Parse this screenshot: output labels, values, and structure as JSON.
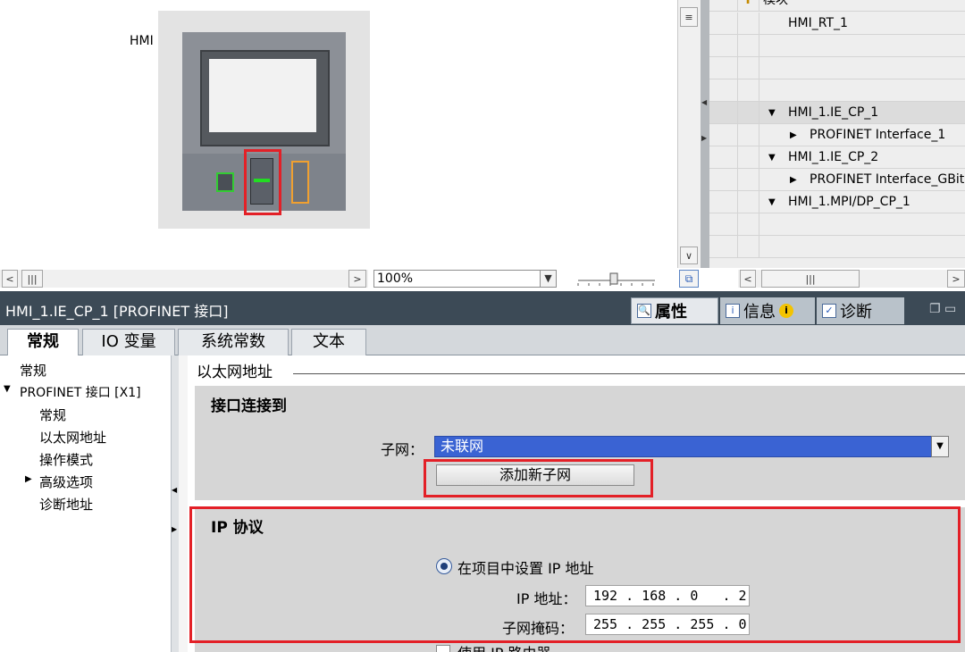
{
  "device_view": {
    "device_label": "HMI",
    "zoom": "100%"
  },
  "network_table": {
    "header": "模块",
    "rows": [
      {
        "label": "HMI_RT_1",
        "expander": ""
      },
      {
        "label": "",
        "expander": ""
      },
      {
        "label": "",
        "expander": ""
      },
      {
        "label": "",
        "expander": ""
      },
      {
        "label": "HMI_1.IE_CP_1",
        "expander": "▼"
      },
      {
        "label": "PROFINET Interface_1",
        "expander": "▶"
      },
      {
        "label": "HMI_1.IE_CP_2",
        "expander": "▼"
      },
      {
        "label": "PROFINET Interface_GBit",
        "expander": "▶"
      },
      {
        "label": "HMI_1.MPI/DP_CP_1",
        "expander": "▼"
      }
    ]
  },
  "inspector": {
    "title": "HMI_1.IE_CP_1 [PROFINET 接口]",
    "tabs": {
      "properties": "属性",
      "info": "信息",
      "diagnostics": "诊断"
    },
    "subtabs": [
      "常规",
      "IO 变量",
      "系统常数",
      "文本"
    ]
  },
  "nav_tree": {
    "items": [
      {
        "label": "常规"
      },
      {
        "label": "PROFINET 接口 [X1]"
      },
      {
        "label": "常规"
      },
      {
        "label": "以太网地址"
      },
      {
        "label": "操作模式"
      },
      {
        "label": "高级选项"
      },
      {
        "label": "诊断地址"
      }
    ]
  },
  "ethernet": {
    "section_title": "以太网地址",
    "conn_group_title": "接口连接到",
    "subnet_label": "子网：",
    "subnet_value": "未联网",
    "add_subnet_button": "添加新子网",
    "ip_group_title": "IP 协议",
    "radio_label": "在项目中设置 IP 地址",
    "ip_label": "IP 地址：",
    "ip_value": "192 . 168 . 0   . 2",
    "mask_label": "子网掩码：",
    "mask_value": "255 . 255 . 255 . 0",
    "router_label": "使用 IP 路由器"
  },
  "colors": {
    "highlight": "#e32027",
    "subnet_selected_bg": "#3a63d3",
    "inspector_bar": "#3c4a56"
  }
}
